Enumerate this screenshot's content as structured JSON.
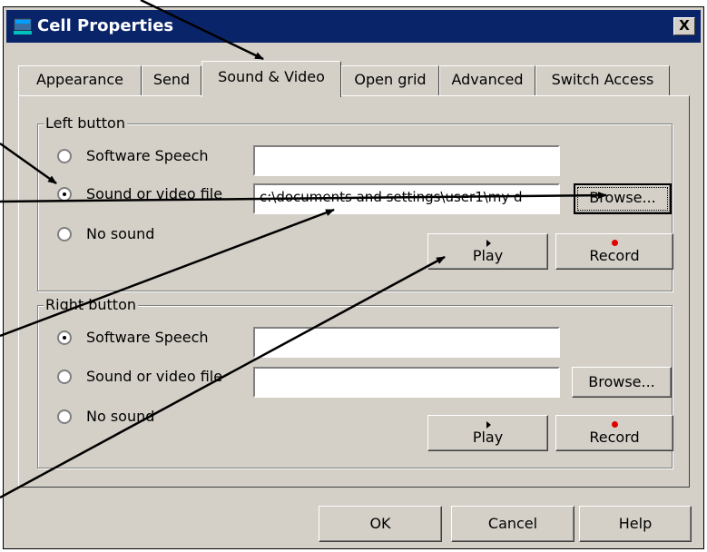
{
  "window": {
    "title": "Cell Properties",
    "close_label": "X"
  },
  "tabs": [
    {
      "label": "Appearance"
    },
    {
      "label": "Send"
    },
    {
      "label": "Sound & Video"
    },
    {
      "label": "Open grid"
    },
    {
      "label": "Advanced"
    },
    {
      "label": "Switch Access"
    }
  ],
  "active_tab": "Sound & Video",
  "left_group": {
    "legend": "Left button",
    "options": [
      "Software Speech",
      "Sound or video file",
      "No sound"
    ],
    "selected": "Sound or video file",
    "speech_value": "",
    "file_value": "c:\\documents and settings\\user1\\my d",
    "browse_label": "Browse...",
    "play_label": "Play",
    "record_label": "Record"
  },
  "right_group": {
    "legend": "Right button",
    "options": [
      "Software Speech",
      "Sound or video file",
      "No sound"
    ],
    "selected": "Software Speech",
    "speech_value": "",
    "file_value": "",
    "browse_label": "Browse...",
    "play_label": "Play",
    "record_label": "Record"
  },
  "footer": {
    "ok_label": "OK",
    "cancel_label": "Cancel",
    "help_label": "Help"
  },
  "colors": {
    "titlebar": "#0a246a",
    "face": "#d4d0c8",
    "record_dot": "#e00000"
  }
}
